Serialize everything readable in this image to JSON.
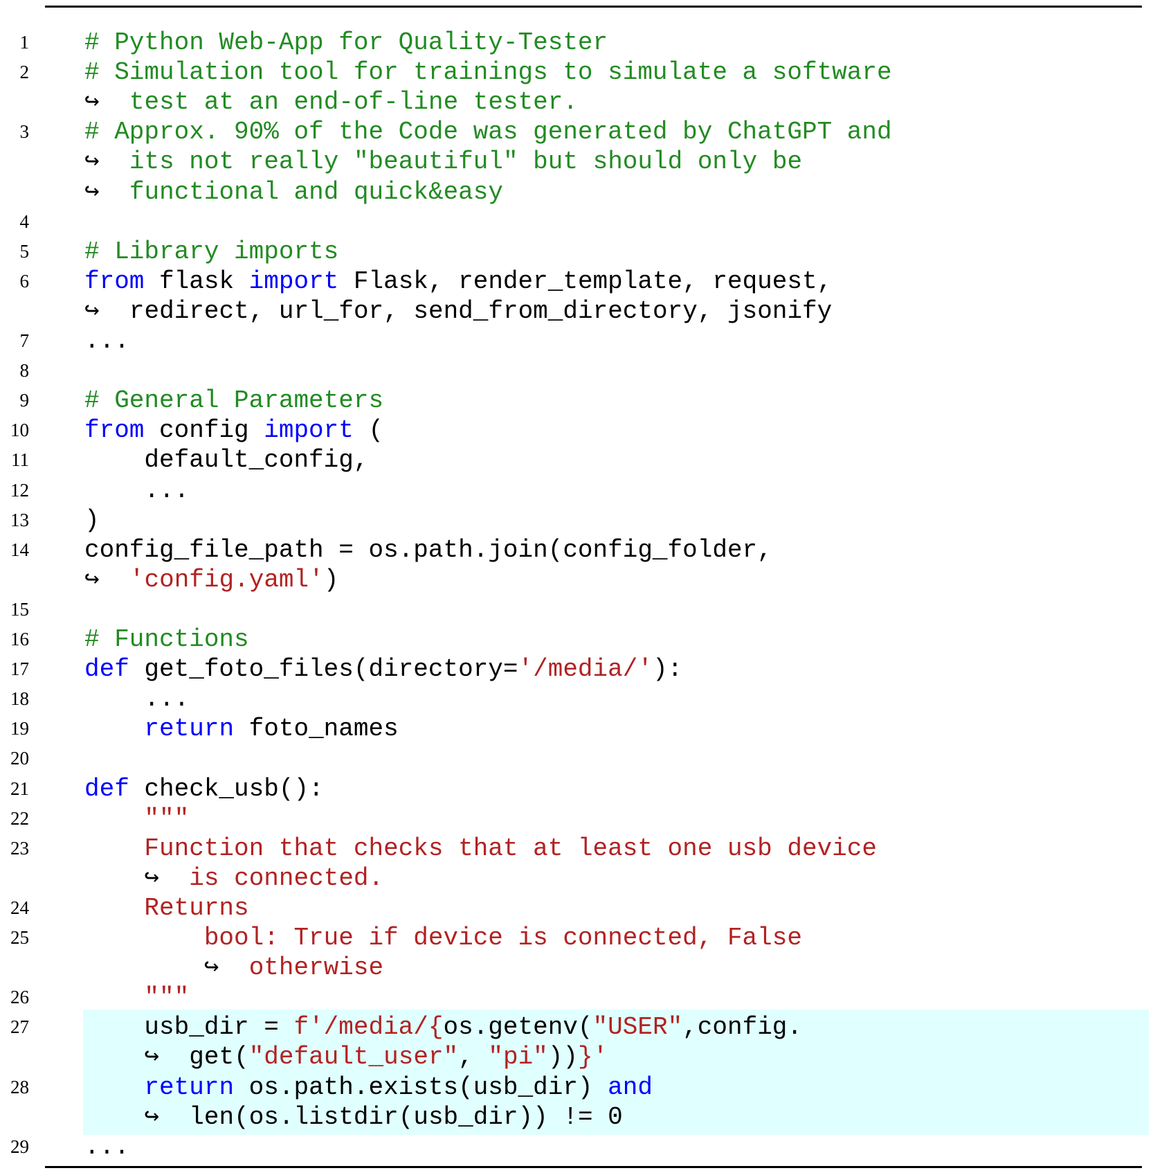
{
  "lines": [
    {
      "n": "1",
      "segs": [
        [
          "c",
          "# Python Web-App for Quality-Tester"
        ]
      ]
    },
    {
      "n": "2",
      "segs": [
        [
          "c",
          "# Simulation tool for trainings to simulate a software"
        ]
      ]
    },
    {
      "n": "",
      "cont": true,
      "indent": 0,
      "segs": [
        [
          "c",
          "test at an end-of-line tester."
        ]
      ]
    },
    {
      "n": "3",
      "segs": [
        [
          "c",
          "# Approx. 90% of the Code was generated by ChatGPT and"
        ]
      ]
    },
    {
      "n": "",
      "cont": true,
      "indent": 0,
      "segs": [
        [
          "c",
          "its not really \"beautiful\" but should only be"
        ]
      ]
    },
    {
      "n": "",
      "cont": true,
      "indent": 0,
      "segs": [
        [
          "c",
          "functional and quick&easy"
        ]
      ]
    },
    {
      "n": "4",
      "segs": []
    },
    {
      "n": "5",
      "segs": [
        [
          "c",
          "# Library imports"
        ]
      ]
    },
    {
      "n": "6",
      "segs": [
        [
          "k",
          "from"
        ],
        [
          "p",
          " flask "
        ],
        [
          "k",
          "import"
        ],
        [
          "p",
          " Flask, render_template, request,"
        ]
      ]
    },
    {
      "n": "",
      "cont": true,
      "indent": 0,
      "segs": [
        [
          "p",
          "redirect, url_for, send_from_directory, jsonify"
        ]
      ]
    },
    {
      "n": "7",
      "segs": [
        [
          "p",
          "..."
        ]
      ]
    },
    {
      "n": "8",
      "segs": []
    },
    {
      "n": "9",
      "segs": [
        [
          "c",
          "# General Parameters"
        ]
      ]
    },
    {
      "n": "10",
      "segs": [
        [
          "k",
          "from"
        ],
        [
          "p",
          " config "
        ],
        [
          "k",
          "import"
        ],
        [
          "p",
          " ("
        ]
      ]
    },
    {
      "n": "11",
      "segs": [
        [
          "p",
          "    default_config,"
        ]
      ]
    },
    {
      "n": "12",
      "segs": [
        [
          "p",
          "    ..."
        ]
      ]
    },
    {
      "n": "13",
      "segs": [
        [
          "p",
          ")"
        ]
      ]
    },
    {
      "n": "14",
      "segs": [
        [
          "p",
          "config_file_path = os.path.join(config_folder,"
        ]
      ]
    },
    {
      "n": "",
      "cont": true,
      "indent": 0,
      "segs": [
        [
          "s",
          "'config.yaml'"
        ],
        [
          "p",
          ")"
        ]
      ]
    },
    {
      "n": "15",
      "segs": []
    },
    {
      "n": "16",
      "segs": [
        [
          "c",
          "# Functions"
        ]
      ]
    },
    {
      "n": "17",
      "segs": [
        [
          "k",
          "def"
        ],
        [
          "p",
          " get_foto_files(directory="
        ],
        [
          "s",
          "'/media/'"
        ],
        [
          "p",
          "):"
        ]
      ]
    },
    {
      "n": "18",
      "segs": [
        [
          "p",
          "    ..."
        ]
      ]
    },
    {
      "n": "19",
      "segs": [
        [
          "p",
          "    "
        ],
        [
          "k",
          "return"
        ],
        [
          "p",
          " foto_names"
        ]
      ]
    },
    {
      "n": "20",
      "segs": []
    },
    {
      "n": "21",
      "segs": [
        [
          "k",
          "def"
        ],
        [
          "p",
          " check_usb():"
        ]
      ]
    },
    {
      "n": "22",
      "segs": [
        [
          "s",
          "    \"\"\""
        ]
      ]
    },
    {
      "n": "23",
      "segs": [
        [
          "s",
          "    Function that checks that at least one usb device"
        ]
      ]
    },
    {
      "n": "",
      "cont": true,
      "indent": 4,
      "segs": [
        [
          "s",
          "is connected."
        ]
      ]
    },
    {
      "n": "24",
      "segs": [
        [
          "s",
          "    Returns"
        ]
      ]
    },
    {
      "n": "25",
      "segs": [
        [
          "s",
          "        bool: True if device is connected, False"
        ]
      ]
    },
    {
      "n": "",
      "cont": true,
      "indent": 8,
      "segs": [
        [
          "s",
          "otherwise"
        ]
      ]
    },
    {
      "n": "26",
      "segs": [
        [
          "s",
          "    \"\"\""
        ]
      ]
    },
    {
      "n": "27",
      "hl": true,
      "segs": [
        [
          "p",
          "    usb_dir = "
        ],
        [
          "s",
          "f'/media/{"
        ],
        [
          "p",
          "os.getenv("
        ],
        [
          "s",
          "\"USER\""
        ],
        [
          "p",
          ",config."
        ]
      ]
    },
    {
      "n": "",
      "cont": true,
      "indent": 4,
      "hl": true,
      "segs": [
        [
          "p",
          "get("
        ],
        [
          "s",
          "\"default_user\""
        ],
        [
          "p",
          ", "
        ],
        [
          "s",
          "\"pi\""
        ],
        [
          "p",
          "))"
        ],
        [
          "s",
          "}'"
        ]
      ]
    },
    {
      "n": "28",
      "hl": true,
      "segs": [
        [
          "p",
          "    "
        ],
        [
          "k",
          "return"
        ],
        [
          "p",
          " os.path.exists(usb_dir) "
        ],
        [
          "k",
          "and"
        ]
      ]
    },
    {
      "n": "",
      "cont": true,
      "indent": 4,
      "hl": true,
      "segs": [
        [
          "p",
          "len(os.listdir(usb_dir)) != 0"
        ]
      ]
    },
    {
      "n": "29",
      "segs": [
        [
          "p",
          "..."
        ]
      ]
    }
  ],
  "continuation_arrow": "↪"
}
